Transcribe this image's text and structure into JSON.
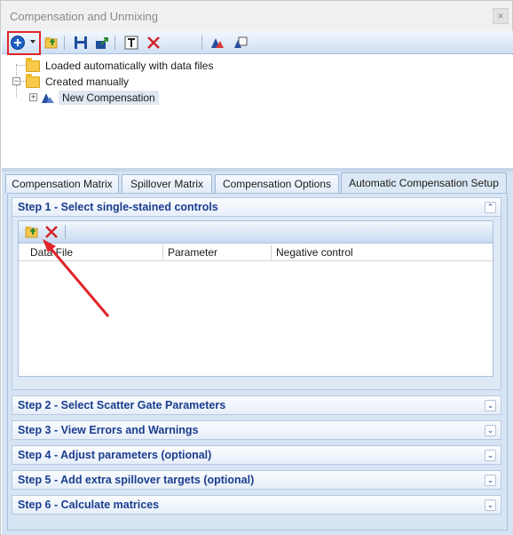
{
  "window": {
    "title": "Compensation and Unmixing",
    "close_glyph": "×"
  },
  "toolbar": {
    "icons": [
      "add-circle-icon",
      "chevron-down-icon",
      "open-folder-icon",
      "save-icon",
      "export-icon",
      "text-icon",
      "delete-x-icon",
      "compensation-view-icon",
      "copy-compensation-icon"
    ]
  },
  "tree": {
    "items": [
      {
        "label": "Loaded automatically with data files"
      },
      {
        "label": "Created manually"
      },
      {
        "label": "New Compensation"
      }
    ],
    "expand_glyph": "+",
    "collapse_glyph": "−"
  },
  "tabs": [
    {
      "label": "Compensation Matrix"
    },
    {
      "label": "Spillover Matrix"
    },
    {
      "label": "Compensation Options"
    },
    {
      "label": "Automatic Compensation Setup"
    }
  ],
  "steps": [
    {
      "title": "Step 1 - Select single-stained controls",
      "expanded": true,
      "chevron": "⌃"
    },
    {
      "title": "Step 2 - Select Scatter Gate Parameters",
      "expanded": false,
      "chevron": "⌄"
    },
    {
      "title": "Step 3 - View Errors and Warnings",
      "expanded": false,
      "chevron": "⌄"
    },
    {
      "title": "Step 4 - Adjust parameters (optional)",
      "expanded": false,
      "chevron": "⌄"
    },
    {
      "title": "Step 5 - Add extra spillover targets (optional)",
      "expanded": false,
      "chevron": "⌄"
    },
    {
      "title": "Step 6 - Calculate matrices",
      "expanded": false,
      "chevron": "⌄"
    }
  ],
  "controls_table": {
    "columns": [
      "Data File",
      "Parameter",
      "Negative control"
    ],
    "rows": []
  },
  "colors": {
    "step_title": "#1a3d8f",
    "highlight": "#e0242a",
    "add_icon": "#1e5fc2"
  }
}
